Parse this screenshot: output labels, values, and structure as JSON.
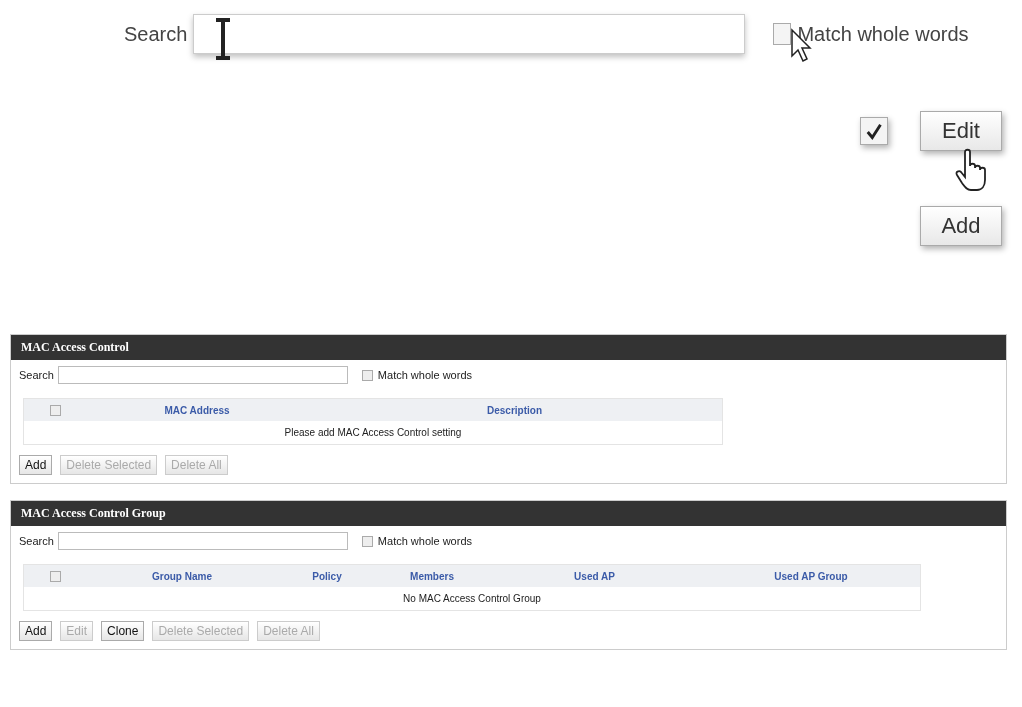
{
  "callout": {
    "search_label": "Search",
    "match_label": "Match whole words",
    "match_checked": false,
    "row_checked": true,
    "edit_button": "Edit",
    "add_button": "Add"
  },
  "panels": [
    {
      "title": "MAC Access Control",
      "search_label": "Search",
      "match_label": "Match whole words",
      "match_checked": false,
      "header_checked": false,
      "columns": [
        "MAC Address",
        "Description"
      ],
      "empty_message": "Please add MAC Access Control setting",
      "buttons": [
        {
          "label": "Add",
          "disabled": false
        },
        {
          "label": "Delete Selected",
          "disabled": true
        },
        {
          "label": "Delete All",
          "disabled": true
        }
      ]
    },
    {
      "title": "MAC Access Control Group",
      "search_label": "Search",
      "match_label": "Match whole words",
      "match_checked": false,
      "header_checked": false,
      "columns": [
        "Group Name",
        "Policy",
        "Members",
        "Used AP",
        "Used AP Group"
      ],
      "empty_message": "No MAC Access Control Group",
      "buttons": [
        {
          "label": "Add",
          "disabled": false
        },
        {
          "label": "Edit",
          "disabled": true
        },
        {
          "label": "Clone",
          "disabled": false
        },
        {
          "label": "Delete Selected",
          "disabled": true
        },
        {
          "label": "Delete All",
          "disabled": true
        }
      ]
    }
  ]
}
